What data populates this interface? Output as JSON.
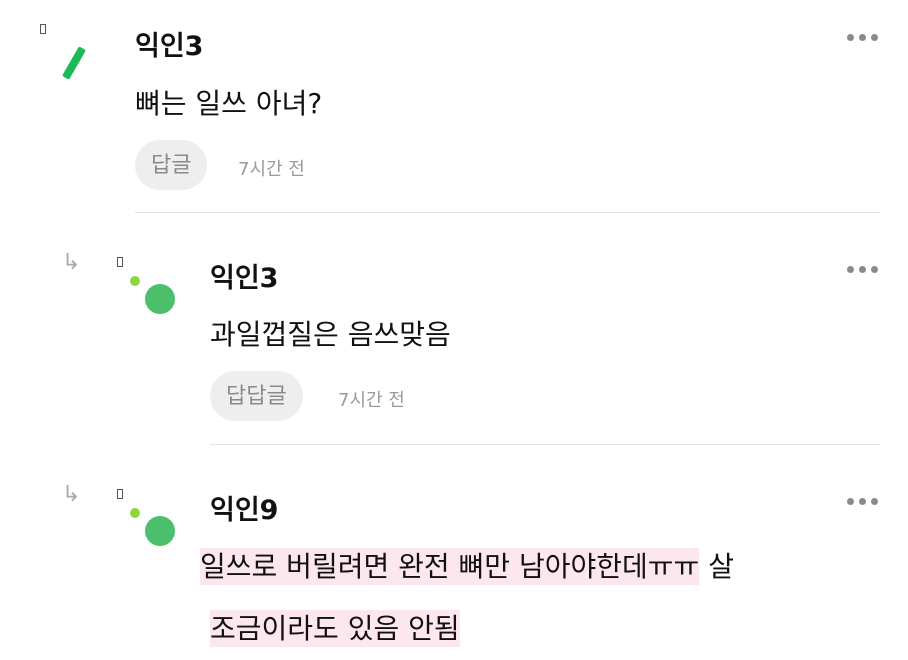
{
  "comments": [
    {
      "nickname": "익인3",
      "text": "뼈는 일쓰 아녀?",
      "reply_label": "답글",
      "time": "7시간 전"
    },
    {
      "nickname": "익인3",
      "text": "과일껍질은 음쓰맞음",
      "reply_label": "답답글",
      "time": "7시간 전"
    },
    {
      "nickname": "익인9",
      "text_line1_highlight": "일쓰로 버릴려면 완전 뼈만 남아야한데ㅠㅠ",
      "text_line1_rest": " 살",
      "text_line2_highlight": "조금이라도 있음 안됨"
    }
  ],
  "icons": {
    "more": "more-icon",
    "reply_arrow": "reply-arrow-icon",
    "avatar": "avatar-icon"
  },
  "colors": {
    "accent_green": "#1db954",
    "avatar_green": "#4cbf6d",
    "avatar_lime": "#8fd63c",
    "highlight_pink": "#fde7ee"
  }
}
